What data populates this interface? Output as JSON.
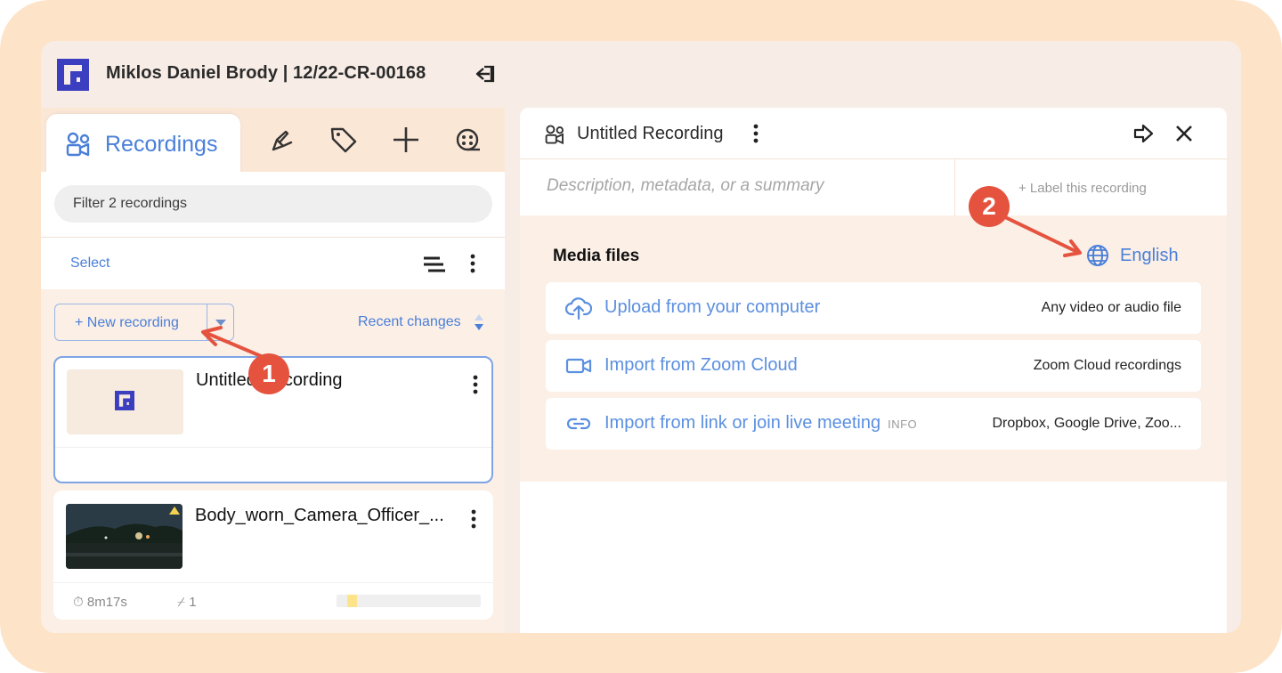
{
  "header": {
    "case_title": "Miklos Daniel Brody | 12/22-CR-00168",
    "collapse_icon": "collapse-sidebar-icon"
  },
  "left_panel": {
    "active_tab": {
      "label": "Recordings",
      "icon": "recordings-icon"
    },
    "tool_tabs": [
      "clip-icon",
      "tag-icon",
      "plus-icon",
      "film-reel-icon"
    ],
    "filter_placeholder": "Filter 2 recordings",
    "select_label": "Select",
    "new_recording_label": "+ New recording",
    "sort_label": "Recent changes",
    "recordings": [
      {
        "title": "Untitled Recording"
      },
      {
        "title": "Body_worn_Camera_Officer_...",
        "duration": "8m17s",
        "clips": "1",
        "progress": 0.07
      }
    ]
  },
  "right_panel": {
    "title": "Untitled Recording",
    "description_placeholder": "Description, metadata, or a summary",
    "label_placeholder": "+ Label this recording",
    "media": {
      "title": "Media files",
      "language": "English",
      "options": [
        {
          "label": "Upload from your computer",
          "info": "",
          "detail": "Any video or audio file",
          "icon": "cloud-upload-icon"
        },
        {
          "label": "Import from Zoom Cloud",
          "info": "",
          "detail": "Zoom Cloud recordings",
          "icon": "video-camera-icon"
        },
        {
          "label": "Import from link or join live meeting",
          "info": "INFO",
          "detail": "Dropbox, Google Drive, Zoo...",
          "icon": "link-icon"
        }
      ]
    }
  },
  "annotations": {
    "step1": "1",
    "step2": "2",
    "color": "#e5533f"
  },
  "colors": {
    "accent": "#4a7fd9",
    "background": "#fde3c8",
    "panel": "#fbefe6"
  }
}
